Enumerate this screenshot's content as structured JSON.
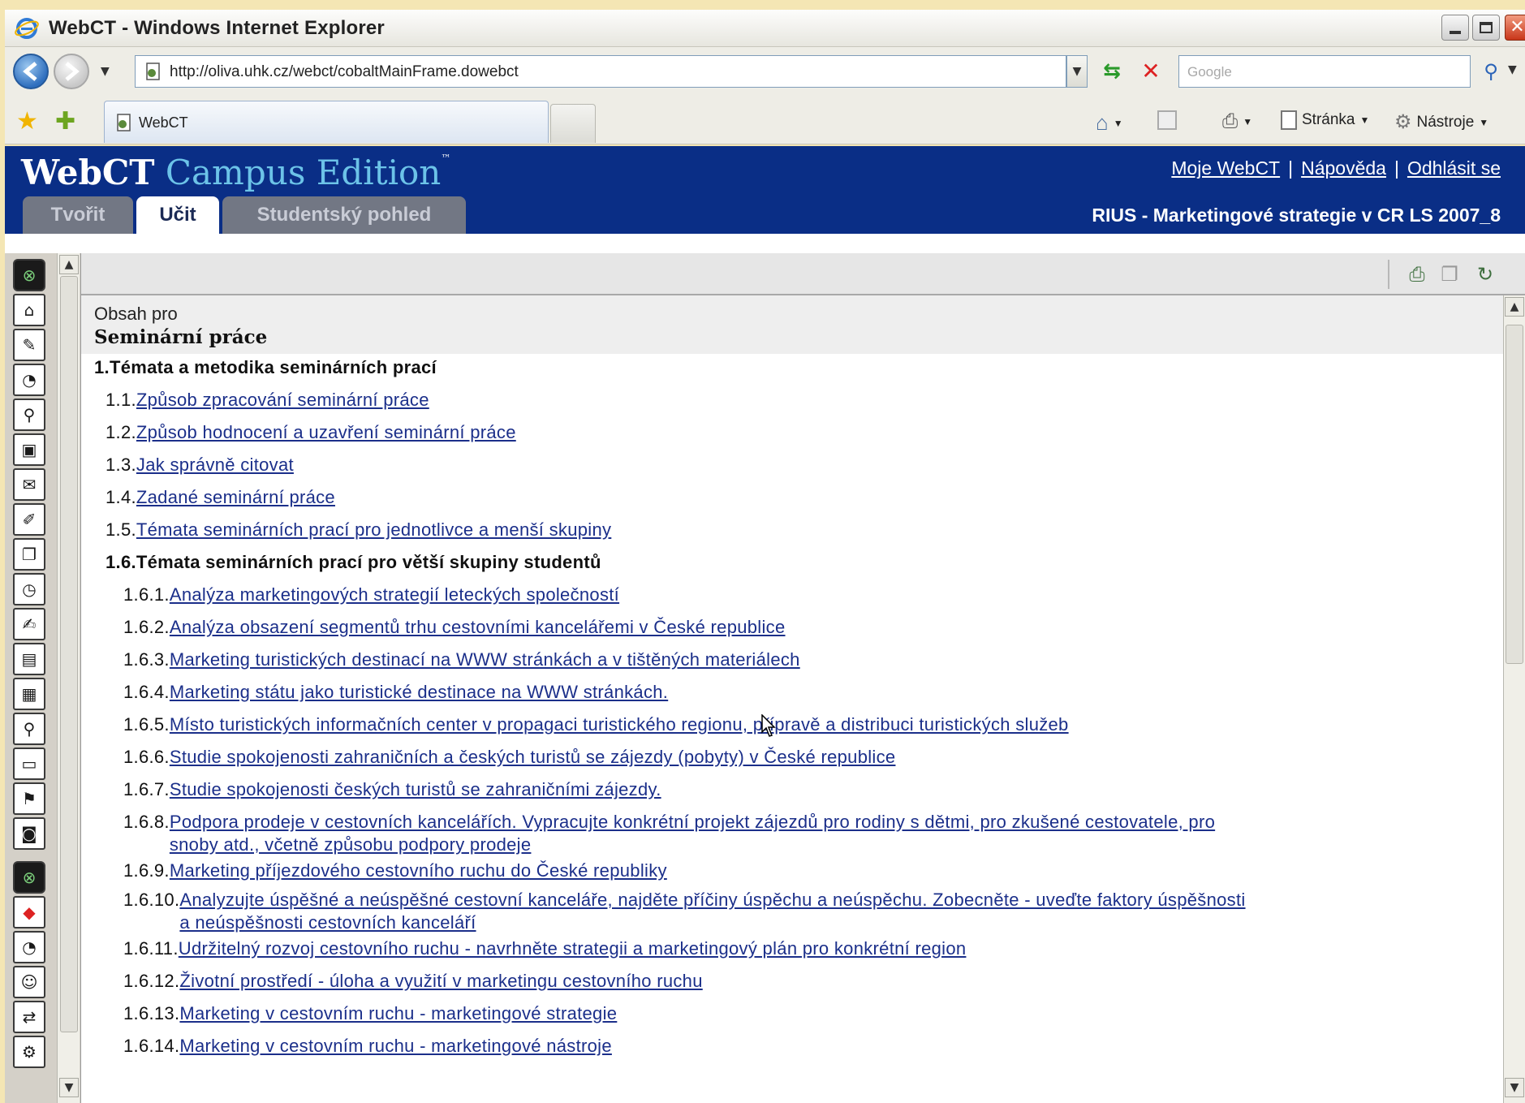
{
  "window": {
    "title": "WebCT - Windows Internet Explorer"
  },
  "browser": {
    "url": "http://oliva.uhk.cz/webct/cobaltMainFrame.dowebct",
    "search_placeholder": "Google",
    "tab_label": "WebCT",
    "commands": {
      "page": "Stránka",
      "tools": "Nástroje"
    }
  },
  "webct": {
    "logo_main": "WebCT",
    "logo_sub": "Campus Edition",
    "logo_tm": "™",
    "links": {
      "my_webct": "Moje WebCT",
      "help": "Nápověda",
      "logout": "Odhlásit se",
      "separator": "|"
    },
    "tabs": {
      "create": "Tvořit",
      "teach": "Učit",
      "student_view": "Studentský pohled"
    },
    "course_title": "RIUS - Marketingové strategie v CR LS 2007_8"
  },
  "content": {
    "header_prefix": "Obsah pro",
    "header_title": "Seminární práce",
    "toc": [
      {
        "num": "1.",
        "text": "Témata a metodika seminárních prací",
        "link": false
      },
      {
        "num": "1.1.",
        "text": "Způsob zpracování seminární práce",
        "link": true
      },
      {
        "num": "1.2.",
        "text": "Způsob hodnocení a uzavření seminární práce",
        "link": true
      },
      {
        "num": "1.3.",
        "text": "Jak správně citovat",
        "link": true
      },
      {
        "num": "1.4.",
        "text": "Zadané seminární práce",
        "link": true
      },
      {
        "num": "1.5.",
        "text": "Témata seminárních prací pro jednotlivce a menší skupiny",
        "link": true
      },
      {
        "num": "1.6.",
        "text": "Témata seminárních prací pro větší skupiny studentů",
        "link": false
      },
      {
        "num": "1.6.1.",
        "text": "Analýza marketingových strategií leteckých společností",
        "link": true
      },
      {
        "num": "1.6.2.",
        "text": "Analýza obsazení segmentů trhu cestovními kancelářemi v České republice",
        "link": true
      },
      {
        "num": "1.6.3.",
        "text": "Marketing turistických destinací na WWW stránkách a v tištěných materiálech",
        "link": true
      },
      {
        "num": "1.6.4.",
        "text": "Marketing státu jako turistické destinace na WWW stránkách.",
        "link": true
      },
      {
        "num": "1.6.5.",
        "text": "Místo turistických informačních center v propagaci turistického regionu, přípravě a distribuci turistických služeb",
        "link": true
      },
      {
        "num": "1.6.6.",
        "text": "Studie spokojenosti zahraničních a českých turistů se zájezdy (pobyty) v České republice",
        "link": true
      },
      {
        "num": "1.6.7.",
        "text": "Studie spokojenosti českých turistů se zahraničními zájezdy.",
        "link": true
      },
      {
        "num": "1.6.8.",
        "text": "Podpora prodeje v cestovních kancelářích. Vypracujte konkrétní projekt zájezdů pro rodiny s dětmi, pro zkušené cestovatele, pro",
        "text2": "snoby atd., včetně způsobu podpory prodeje",
        "link": true
      },
      {
        "num": "1.6.9.",
        "text": "Marketing příjezdového cestovního ruchu do České republiky",
        "link": true
      },
      {
        "num": "1.6.10.",
        "text": "Analyzujte úspěšné a neúspěšné cestovní kanceláře, najděte příčiny úspěchu a neúspěchu. Zobecněte - uveďte faktory úspěšnosti",
        "text2": "a neúspěšnosti cestovních kanceláří",
        "link": true
      },
      {
        "num": "1.6.11.",
        "text": "Udržitelný rozvoj cestovního ruchu - navrhněte strategii a marketingový plán pro konkrétní region",
        "link": true
      },
      {
        "num": "1.6.12.",
        "text": "Životní prostředí - úloha a využití v marketingu cestovního ruchu",
        "link": true
      },
      {
        "num": "1.6.13.",
        "text": "Marketing v cestovním ruchu - marketingové strategie",
        "link": true
      },
      {
        "num": "1.6.14.",
        "text": "Marketing v cestovním ruchu - marketingové nástroje",
        "link": true
      }
    ]
  }
}
